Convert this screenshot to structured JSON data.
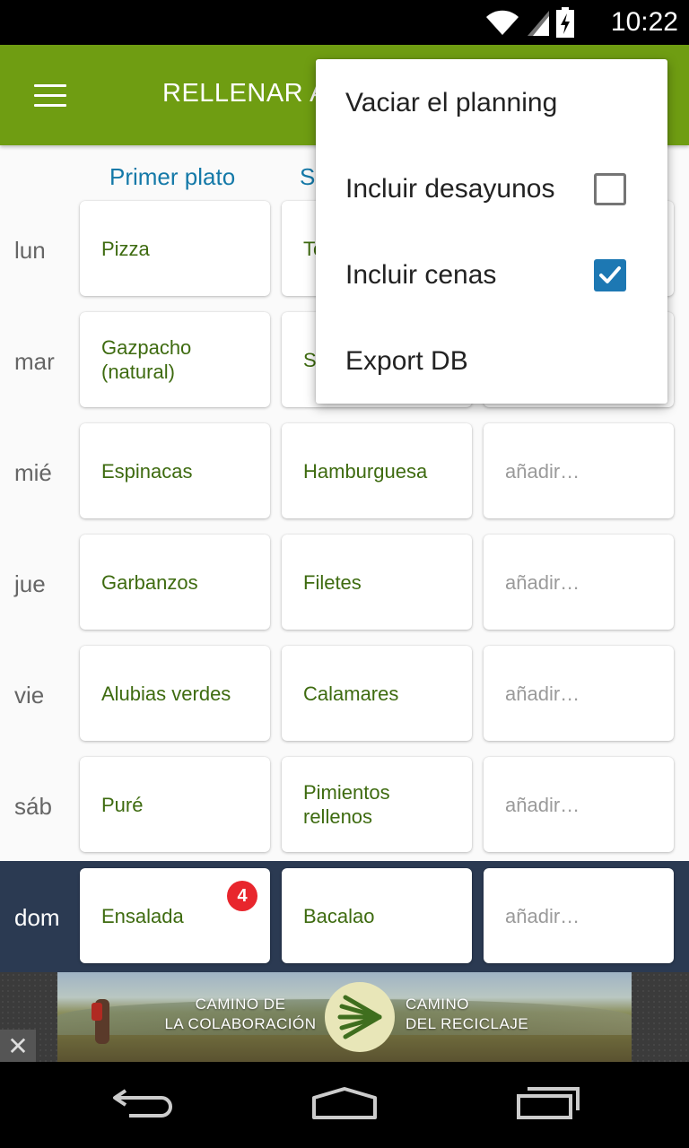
{
  "status_bar": {
    "time": "10:22"
  },
  "app_bar": {
    "title": "RELLENAR A"
  },
  "columns": {
    "first": "Primer plato",
    "second": "S"
  },
  "rows": [
    {
      "day": "lun",
      "c1": "Pizza",
      "c2": "To",
      "c3": ""
    },
    {
      "day": "mar",
      "c1": "Gazpacho (natural)",
      "c2": "S",
      "c3": ""
    },
    {
      "day": "mié",
      "c1": "Espinacas",
      "c2": "Hamburguesa",
      "c3": "añadir…"
    },
    {
      "day": "jue",
      "c1": "Garbanzos",
      "c2": "Filetes",
      "c3": "añadir…"
    },
    {
      "day": "vie",
      "c1": "Alubias verdes",
      "c2": "Calamares",
      "c3": "añadir…"
    },
    {
      "day": "sáb",
      "c1": "Puré",
      "c2": "Pimientos rellenos",
      "c3": "añadir…"
    },
    {
      "day": "dom",
      "c1": "Ensalada",
      "c1_badge": "4",
      "c2": "Bacalao",
      "c3": "añadir…",
      "today": true
    }
  ],
  "menu": {
    "items": [
      {
        "label": "Vaciar el planning"
      },
      {
        "label": "Incluir desayunos",
        "checked": false
      },
      {
        "label": "Incluir cenas",
        "checked": true
      },
      {
        "label": "Export DB"
      }
    ]
  },
  "ad": {
    "left_line1": "CAMINO DE",
    "left_line2": "LA COLABORACIÓN",
    "right_line1": "CAMINO",
    "right_line2": "DEL RECICLAJE",
    "close": "✕"
  },
  "colors": {
    "app_bar": "#6f9d12",
    "header_text": "#1479a8",
    "cell_text": "#3e6b10",
    "today_row": "#2b3a52",
    "badge": "#e8262d",
    "checkbox_on": "#1d78b3"
  },
  "icons": [
    "wifi-icon",
    "signal-icon",
    "battery-charging-icon",
    "menu-icon",
    "back-icon",
    "home-icon",
    "recents-icon",
    "scallop-shell-icon"
  ]
}
